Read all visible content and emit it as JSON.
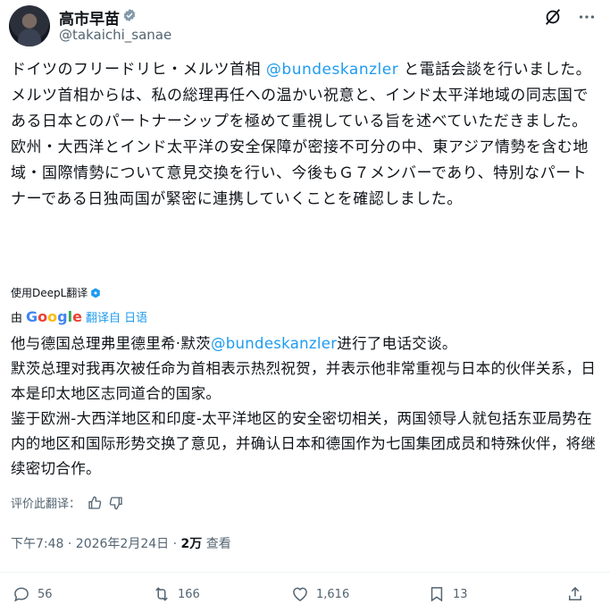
{
  "author": {
    "name": "高市早苗",
    "handle": "@takaichi_sanae"
  },
  "tweet": {
    "line1a": "ドイツのフリードリヒ・メルツ首相 ",
    "mention": "@bundeskanzler",
    "line1b": " と電話会談を行いました。",
    "para2": "メルツ首相からは、私の総理再任への温かい祝意と、インド太平洋地域の同志国である日本とのパートナーシップを極めて重視している旨を述べていただきました。",
    "para3": "欧州・大西洋とインド太平洋の安全保障が密接不可分の中、東アジア情勢を含む地域・国際情勢について意見交換を行い、今後もＧ７メンバーであり、特別なパートナーである日独両国が緊密に連携していくことを確認しました。"
  },
  "deepl_label": "使用DeepL翻译",
  "translation_by": {
    "prefix": "由",
    "google": [
      "G",
      "o",
      "o",
      "g",
      "l",
      "e"
    ],
    "label": "翻译自 日语"
  },
  "translation": {
    "line1a": "他与德国总理弗里德里希·默茨",
    "mention": "@bundeskanzler",
    "line1b": "进行了电话交谈。",
    "para2": "默茨总理对我再次被任命为首相表示热烈祝贺，并表示他非常重视与日本的伙伴关系，日本是印太地区志同道合的国家。",
    "para3": "鉴于欧洲-大西洋地区和印度-太平洋地区的安全密切相关，两国领导人就包括东亚局势在内的地区和国际形势交换了意见，并确认日本和德国作为七国集团成员和特殊伙伴，将继续密切合作。"
  },
  "rate_label": "评价此翻译：",
  "meta": {
    "time": "下午7:48 · 2026年2月24日 · ",
    "views": "2万",
    "views_label": " 查看"
  },
  "actions": {
    "replies": "56",
    "reposts": "166",
    "likes": "1,616",
    "bookmarks": "13"
  },
  "colors": {
    "link": "#1d9bf0",
    "muted": "#536471",
    "text": "#0f1419"
  }
}
